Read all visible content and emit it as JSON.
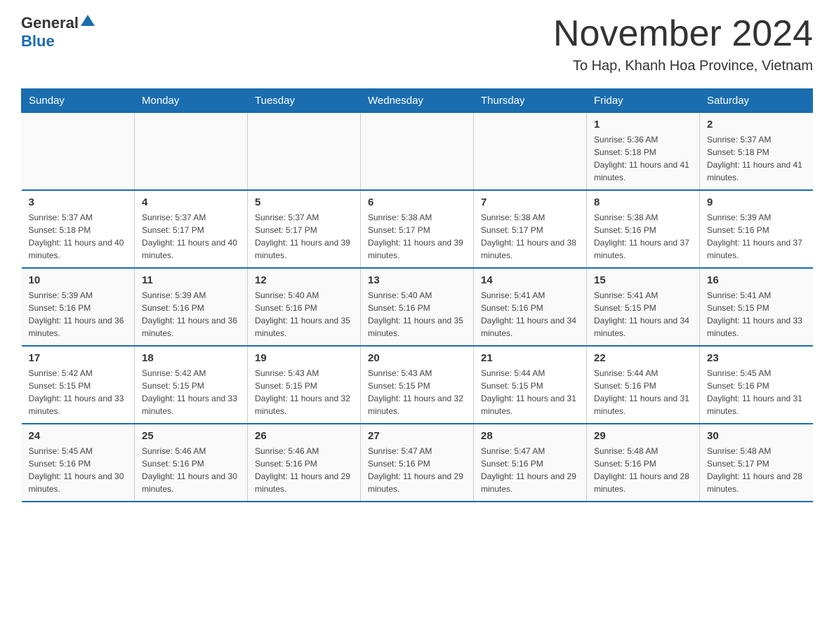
{
  "header": {
    "logo_general": "General",
    "logo_blue": "Blue",
    "month_title": "November 2024",
    "location": "To Hap, Khanh Hoa Province, Vietnam"
  },
  "days_of_week": [
    "Sunday",
    "Monday",
    "Tuesday",
    "Wednesday",
    "Thursday",
    "Friday",
    "Saturday"
  ],
  "weeks": [
    {
      "days": [
        {
          "num": "",
          "info": ""
        },
        {
          "num": "",
          "info": ""
        },
        {
          "num": "",
          "info": ""
        },
        {
          "num": "",
          "info": ""
        },
        {
          "num": "",
          "info": ""
        },
        {
          "num": "1",
          "info": "Sunrise: 5:36 AM\nSunset: 5:18 PM\nDaylight: 11 hours and 41 minutes."
        },
        {
          "num": "2",
          "info": "Sunrise: 5:37 AM\nSunset: 5:18 PM\nDaylight: 11 hours and 41 minutes."
        }
      ]
    },
    {
      "days": [
        {
          "num": "3",
          "info": "Sunrise: 5:37 AM\nSunset: 5:18 PM\nDaylight: 11 hours and 40 minutes."
        },
        {
          "num": "4",
          "info": "Sunrise: 5:37 AM\nSunset: 5:17 PM\nDaylight: 11 hours and 40 minutes."
        },
        {
          "num": "5",
          "info": "Sunrise: 5:37 AM\nSunset: 5:17 PM\nDaylight: 11 hours and 39 minutes."
        },
        {
          "num": "6",
          "info": "Sunrise: 5:38 AM\nSunset: 5:17 PM\nDaylight: 11 hours and 39 minutes."
        },
        {
          "num": "7",
          "info": "Sunrise: 5:38 AM\nSunset: 5:17 PM\nDaylight: 11 hours and 38 minutes."
        },
        {
          "num": "8",
          "info": "Sunrise: 5:38 AM\nSunset: 5:16 PM\nDaylight: 11 hours and 37 minutes."
        },
        {
          "num": "9",
          "info": "Sunrise: 5:39 AM\nSunset: 5:16 PM\nDaylight: 11 hours and 37 minutes."
        }
      ]
    },
    {
      "days": [
        {
          "num": "10",
          "info": "Sunrise: 5:39 AM\nSunset: 5:16 PM\nDaylight: 11 hours and 36 minutes."
        },
        {
          "num": "11",
          "info": "Sunrise: 5:39 AM\nSunset: 5:16 PM\nDaylight: 11 hours and 36 minutes."
        },
        {
          "num": "12",
          "info": "Sunrise: 5:40 AM\nSunset: 5:16 PM\nDaylight: 11 hours and 35 minutes."
        },
        {
          "num": "13",
          "info": "Sunrise: 5:40 AM\nSunset: 5:16 PM\nDaylight: 11 hours and 35 minutes."
        },
        {
          "num": "14",
          "info": "Sunrise: 5:41 AM\nSunset: 5:16 PM\nDaylight: 11 hours and 34 minutes."
        },
        {
          "num": "15",
          "info": "Sunrise: 5:41 AM\nSunset: 5:15 PM\nDaylight: 11 hours and 34 minutes."
        },
        {
          "num": "16",
          "info": "Sunrise: 5:41 AM\nSunset: 5:15 PM\nDaylight: 11 hours and 33 minutes."
        }
      ]
    },
    {
      "days": [
        {
          "num": "17",
          "info": "Sunrise: 5:42 AM\nSunset: 5:15 PM\nDaylight: 11 hours and 33 minutes."
        },
        {
          "num": "18",
          "info": "Sunrise: 5:42 AM\nSunset: 5:15 PM\nDaylight: 11 hours and 33 minutes."
        },
        {
          "num": "19",
          "info": "Sunrise: 5:43 AM\nSunset: 5:15 PM\nDaylight: 11 hours and 32 minutes."
        },
        {
          "num": "20",
          "info": "Sunrise: 5:43 AM\nSunset: 5:15 PM\nDaylight: 11 hours and 32 minutes."
        },
        {
          "num": "21",
          "info": "Sunrise: 5:44 AM\nSunset: 5:15 PM\nDaylight: 11 hours and 31 minutes."
        },
        {
          "num": "22",
          "info": "Sunrise: 5:44 AM\nSunset: 5:16 PM\nDaylight: 11 hours and 31 minutes."
        },
        {
          "num": "23",
          "info": "Sunrise: 5:45 AM\nSunset: 5:16 PM\nDaylight: 11 hours and 31 minutes."
        }
      ]
    },
    {
      "days": [
        {
          "num": "24",
          "info": "Sunrise: 5:45 AM\nSunset: 5:16 PM\nDaylight: 11 hours and 30 minutes."
        },
        {
          "num": "25",
          "info": "Sunrise: 5:46 AM\nSunset: 5:16 PM\nDaylight: 11 hours and 30 minutes."
        },
        {
          "num": "26",
          "info": "Sunrise: 5:46 AM\nSunset: 5:16 PM\nDaylight: 11 hours and 29 minutes."
        },
        {
          "num": "27",
          "info": "Sunrise: 5:47 AM\nSunset: 5:16 PM\nDaylight: 11 hours and 29 minutes."
        },
        {
          "num": "28",
          "info": "Sunrise: 5:47 AM\nSunset: 5:16 PM\nDaylight: 11 hours and 29 minutes."
        },
        {
          "num": "29",
          "info": "Sunrise: 5:48 AM\nSunset: 5:16 PM\nDaylight: 11 hours and 28 minutes."
        },
        {
          "num": "30",
          "info": "Sunrise: 5:48 AM\nSunset: 5:17 PM\nDaylight: 11 hours and 28 minutes."
        }
      ]
    }
  ]
}
